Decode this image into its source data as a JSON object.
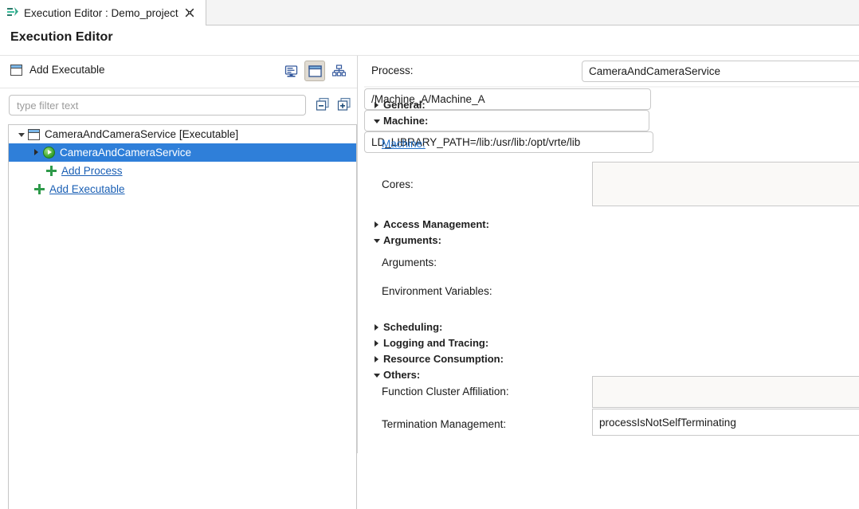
{
  "tab": {
    "label": "Execution Editor : Demo_project",
    "icon": "execution-editor-icon",
    "close_icon": "close-icon"
  },
  "editor": {
    "title": "Execution Editor"
  },
  "left_pane": {
    "toolbar": {
      "add_executable_label": "Add Executable",
      "add_executable_icon": "window-icon",
      "view_buttons": [
        {
          "name": "form-view-button",
          "icon": "monitor-icon",
          "selected": false
        },
        {
          "name": "tree-view-button",
          "icon": "window-icon",
          "selected": true
        },
        {
          "name": "hierarchy-view-button",
          "icon": "hierarchy-icon",
          "selected": false
        }
      ]
    },
    "filter": {
      "placeholder": "type filter text",
      "value": "",
      "collapse_all_icon": "collapse-all-icon",
      "expand_all_icon": "expand-all-icon"
    },
    "tree": [
      {
        "label": "CameraAndCameraService [Executable]",
        "icon": "window-icon",
        "twisty": "down",
        "indent": 0,
        "selected": false,
        "link": false
      },
      {
        "label": "CameraAndCameraService",
        "icon": "process-icon",
        "twisty": "right",
        "indent": 1,
        "selected": true,
        "link": false
      },
      {
        "label": "Add Process",
        "icon": "plus-icon",
        "twisty": "none",
        "indent": 2,
        "selected": false,
        "link": true
      },
      {
        "label": "Add Executable",
        "icon": "plus-icon",
        "twisty": "none",
        "indent": 1,
        "selected": false,
        "link": true
      }
    ]
  },
  "right_pane": {
    "process": {
      "label": "Process:",
      "value": "CameraAndCameraService"
    },
    "sections": [
      {
        "label": "General:",
        "expanded": false
      },
      {
        "label": "Machine:",
        "expanded": true
      },
      {
        "label": "Access Management:",
        "expanded": false
      },
      {
        "label": "Arguments:",
        "expanded": true
      },
      {
        "label": "Scheduling:",
        "expanded": false
      },
      {
        "label": "Logging and Tracing:",
        "expanded": false
      },
      {
        "label": "Resource Consumption:",
        "expanded": false
      },
      {
        "label": "Others:",
        "expanded": true
      }
    ],
    "fields": [
      {
        "label": "Machine:",
        "value": "/Machine_A/Machine_A",
        "is_link": true,
        "kind": "text"
      },
      {
        "label": "Cores:",
        "value": "",
        "is_link": false,
        "kind": "readonly-area"
      },
      {
        "label": "Arguments:",
        "value": "",
        "is_link": false,
        "kind": "text"
      },
      {
        "label": "Environment Variables:",
        "value": "LD_LIBRARY_PATH=/lib:/usr/lib:/opt/vrte/lib",
        "is_link": false,
        "kind": "text"
      },
      {
        "label": "Function Cluster Affiliation:",
        "value": "",
        "is_link": false,
        "kind": "readonly-area"
      },
      {
        "label": "Termination Management:",
        "value": "processIsNotSelfTerminating",
        "is_link": false,
        "kind": "readonly"
      }
    ]
  },
  "colors": {
    "selection_blue": "#2f7fd9",
    "link_blue": "#1a5fb4",
    "plus_green": "#2e9a4a",
    "toolbar_selected": "#e0dbd2"
  }
}
